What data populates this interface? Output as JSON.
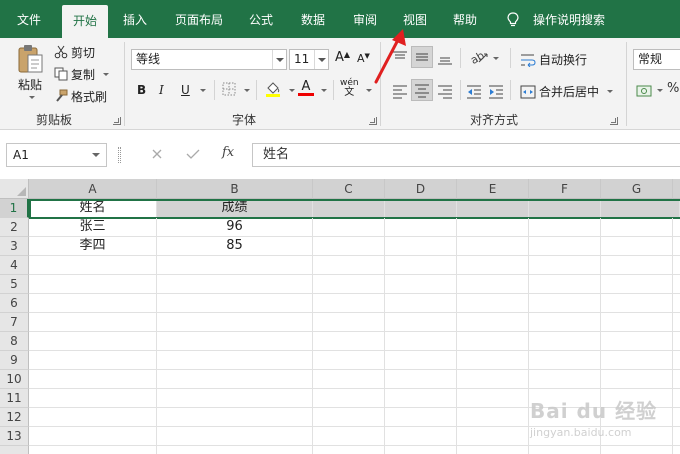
{
  "menu": {
    "tabs": [
      "文件",
      "开始",
      "插入",
      "页面布局",
      "公式",
      "数据",
      "审阅",
      "视图",
      "帮助"
    ],
    "active_tab": "开始",
    "search": "操作说明搜索"
  },
  "ribbon": {
    "clipboard": {
      "paste": "粘贴",
      "cut": "剪切",
      "copy": "复制",
      "format_painter": "格式刷",
      "label": "剪贴板"
    },
    "font": {
      "name": "等线",
      "size": "11",
      "bold": "B",
      "italic": "I",
      "underline": "U",
      "phonetic": "wén",
      "label": "字体"
    },
    "alignment": {
      "wrap": "自动换行",
      "merge": "合并后居中",
      "label": "对齐方式"
    },
    "number": {
      "format": "常规"
    }
  },
  "formula_bar": {
    "name_box": "A1",
    "fx": "fx",
    "content": "姓名"
  },
  "grid": {
    "columns": [
      "A",
      "B",
      "C",
      "D",
      "E",
      "F",
      "G"
    ],
    "rows": [
      "1",
      "2",
      "3",
      "4",
      "5",
      "6",
      "7",
      "8",
      "9",
      "10",
      "11",
      "12",
      "13"
    ],
    "cells": [
      [
        "姓名",
        "成绩"
      ],
      [
        "张三",
        "96"
      ],
      [
        "李四",
        "85"
      ]
    ]
  },
  "watermark": {
    "brand": "Bai du 经验",
    "url": "jingyan.baidu.com"
  },
  "colors": {
    "accent": "#217346",
    "arrow": "#e02020"
  }
}
